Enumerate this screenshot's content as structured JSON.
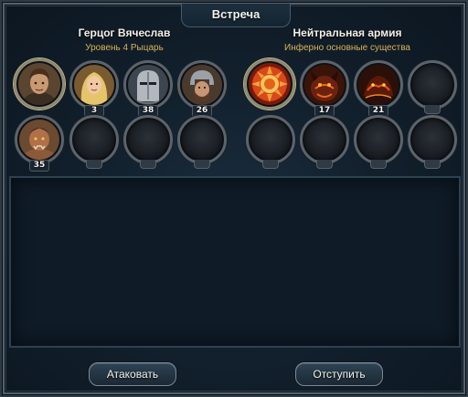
{
  "dialog": {
    "title": "Встреча",
    "attack_label": "Атаковать",
    "retreat_label": "Отступить"
  },
  "player": {
    "hero_name": "Герцог Вячеслав",
    "hero_subtitle": "Уровень 4 Рыцарь",
    "units": [
      {
        "kind": "hero-portrait-icon",
        "count": ""
      },
      {
        "kind": "blonde-woman-portrait-icon",
        "count": "3"
      },
      {
        "kind": "knight-helmet-portrait-icon",
        "count": "38"
      },
      {
        "kind": "soldier-helmet-portrait-icon",
        "count": "26"
      },
      {
        "kind": "orc-warrior-portrait-icon",
        "count": "35"
      },
      {
        "kind": "empty-slot",
        "count": ""
      },
      {
        "kind": "empty-slot",
        "count": ""
      },
      {
        "kind": "empty-slot",
        "count": ""
      }
    ]
  },
  "enemy": {
    "army_name": "Нейтральная армия",
    "army_subtitle": "Инферно основные существа",
    "units": [
      {
        "kind": "inferno-sun-emblem-icon",
        "count": ""
      },
      {
        "kind": "lava-demon-portrait-icon",
        "count": "17"
      },
      {
        "kind": "hell-hound-portrait-icon",
        "count": "21"
      },
      {
        "kind": "empty-slot",
        "count": ""
      },
      {
        "kind": "empty-slot",
        "count": ""
      },
      {
        "kind": "empty-slot",
        "count": ""
      },
      {
        "kind": "empty-slot",
        "count": ""
      },
      {
        "kind": "empty-slot",
        "count": ""
      }
    ]
  },
  "colors": {
    "title_text": "#f2f2ee",
    "subtitle_gold": "#d8b45a",
    "panel_bg": "#12202d"
  }
}
